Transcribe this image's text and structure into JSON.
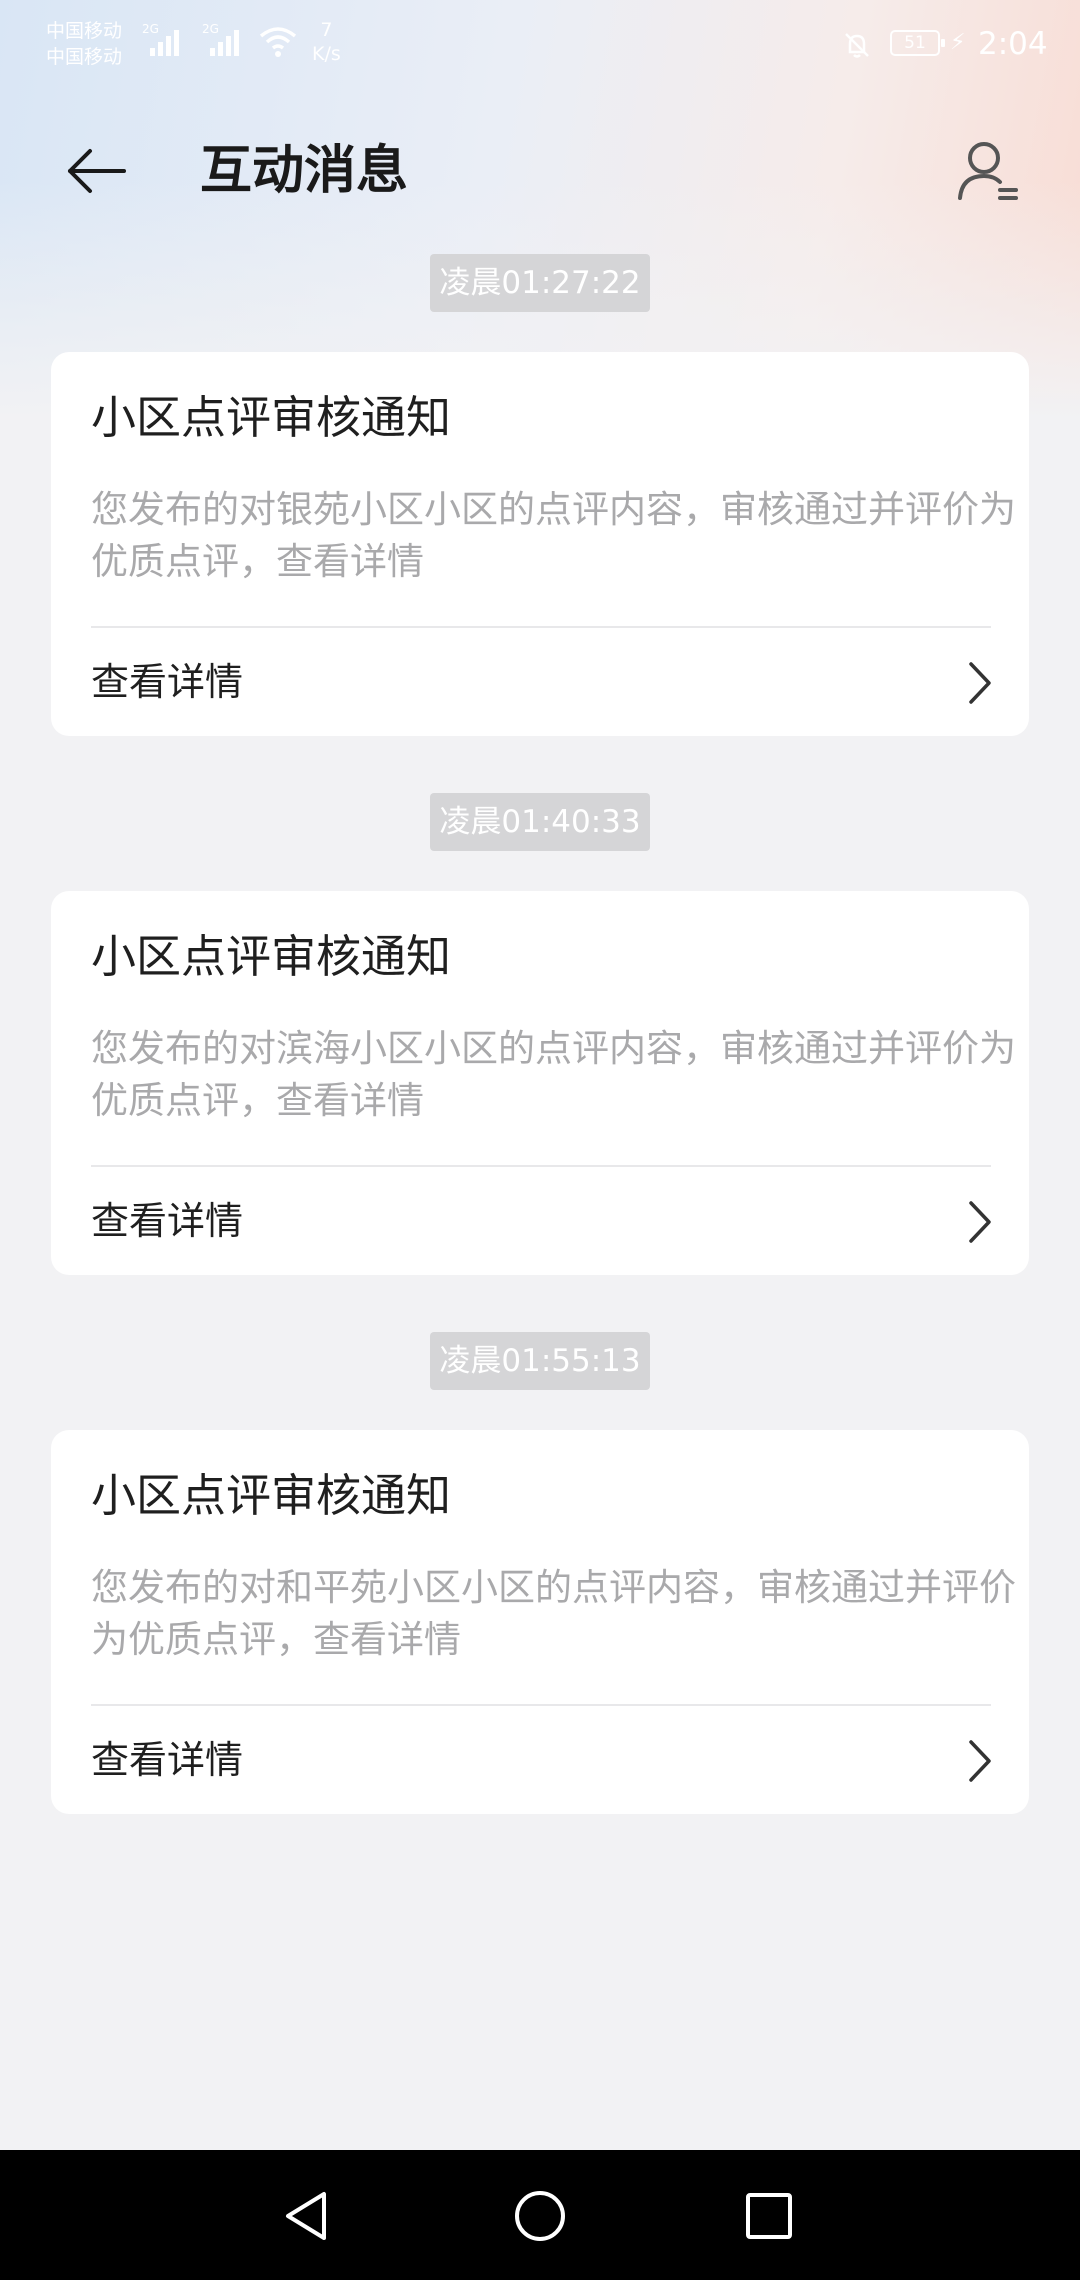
{
  "status_bar": {
    "carrier_1": "中国移动",
    "carrier_2": "中国移动",
    "network_1": "2G",
    "network_2": "2G",
    "speed_value": "7",
    "speed_unit": "K/s",
    "battery": "51",
    "time": "2:04",
    "icons": [
      "signal-icon",
      "signal-icon",
      "wifi-icon",
      "bell-off-icon",
      "battery-icon",
      "charging-icon"
    ]
  },
  "header": {
    "title": "互动消息",
    "back_icon": "arrow-left-icon",
    "profile_icon": "user-list-icon"
  },
  "messages": [
    {
      "time": "凌晨01:27:22",
      "title": "小区点评审核通知",
      "body": "您发布的对银苑小区小区的点评内容，审核通过并评价为优质点评，查看详情",
      "action": "查看详情"
    },
    {
      "time": "凌晨01:40:33",
      "title": "小区点评审核通知",
      "body": "您发布的对滨海小区小区的点评内容，审核通过并评价为优质点评，查看详情",
      "action": "查看详情"
    },
    {
      "time": "凌晨01:55:13",
      "title": "小区点评审核通知",
      "body": "您发布的对和平苑小区小区的点评内容，审核通过并评价为优质点评，查看详情",
      "action": "查看详情"
    }
  ],
  "nav": {
    "back_icon": "triangle-back-icon",
    "home_icon": "circle-home-icon",
    "recents_icon": "square-recents-icon"
  },
  "colors": {
    "background": "#f2f2f4",
    "card": "#ffffff",
    "timestamp_bg": "#d5d5d7",
    "title_text": "#1f1f1f",
    "body_text": "#a9a9ab",
    "nav_bar": "#000000"
  }
}
